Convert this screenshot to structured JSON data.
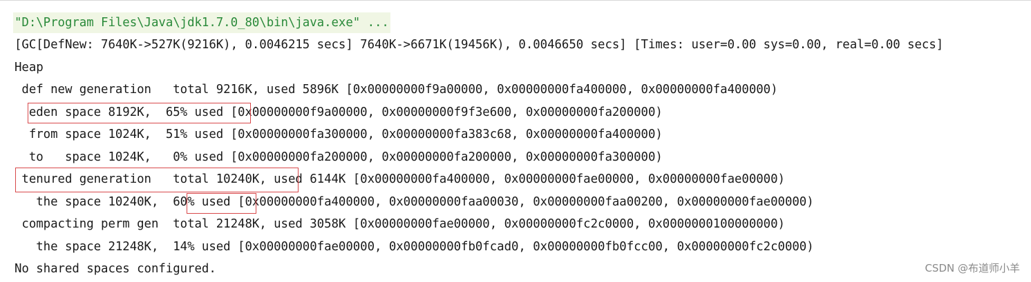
{
  "console": {
    "command_line": "\"D:\\Program Files\\Java\\jdk1.7.0_80\\bin\\java.exe\" ...",
    "lines": [
      "[GC[DefNew: 7640K->527K(9216K), 0.0046215 secs] 7640K->6671K(19456K), 0.0046650 secs] [Times: user=0.00 sys=0.00, real=0.00 secs]",
      "Heap",
      " def new generation   total 9216K, used 5896K [0x00000000f9a00000, 0x00000000fa400000, 0x00000000fa400000)",
      "  eden space 8192K,  65% used [0x00000000f9a00000, 0x00000000f9f3e600, 0x00000000fa200000)",
      "  from space 1024K,  51% used [0x00000000fa300000, 0x00000000fa383c68, 0x00000000fa400000)",
      "  to   space 1024K,   0% used [0x00000000fa200000, 0x00000000fa200000, 0x00000000fa300000)",
      " tenured generation   total 10240K, used 6144K [0x00000000fa400000, 0x00000000fae00000, 0x00000000fae00000)",
      "   the space 10240K,  60% used [0x00000000fa400000, 0x00000000faa00030, 0x00000000faa00200, 0x00000000fae00000)",
      " compacting perm gen  total 21248K, used 3058K [0x00000000fae00000, 0x00000000fc2c0000, 0x0000000100000000)",
      "   the space 21248K,  14% used [0x00000000fae00000, 0x00000000fb0fcad0, 0x00000000fb0fcc00, 0x00000000fc2c0000)",
      "No shared spaces configured."
    ]
  },
  "watermark": "CSDN @布道师小羊",
  "highlight_color": "#d8484a"
}
